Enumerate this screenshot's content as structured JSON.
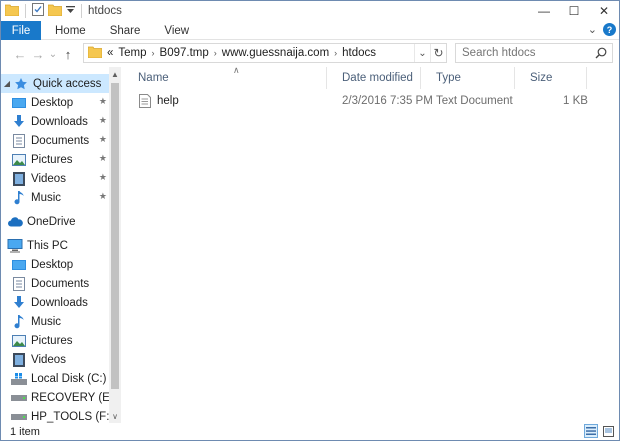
{
  "window": {
    "title": "htdocs",
    "controls": {
      "minimize": "—",
      "maximize": "☐",
      "close": "✕"
    }
  },
  "ribbon": {
    "tabs": [
      "File",
      "Home",
      "Share",
      "View"
    ],
    "expand_glyph": "⌄",
    "help_glyph": "?"
  },
  "address": {
    "back_glyph": "←",
    "forward_glyph": "→",
    "recent_glyph": "⌄",
    "up_glyph": "↑",
    "overflow": "«",
    "crumbs": [
      "Temp",
      "B097.tmp",
      "www.guessnaija.com",
      "htdocs"
    ],
    "separator": "›",
    "dropdown_glyph": "⌄",
    "refresh_glyph": "↻"
  },
  "search": {
    "placeholder": "Search htdocs"
  },
  "nav": {
    "quick_access": "Quick access",
    "quick_items": [
      "Desktop",
      "Downloads",
      "Documents",
      "Pictures",
      "Videos",
      "Music"
    ],
    "onedrive": "OneDrive",
    "this_pc": "This PC",
    "pc_items": [
      "Desktop",
      "Documents",
      "Downloads",
      "Music",
      "Pictures",
      "Videos",
      "Local Disk (C:)",
      "RECOVERY (E:)",
      "HP_TOOLS (F:)"
    ],
    "pin_glyph": "★",
    "scroll_up": "▲",
    "scroll_down": "∨"
  },
  "files": {
    "columns": {
      "name": "Name",
      "date": "Date modified",
      "type": "Type",
      "size": "Size"
    },
    "sort_glyph": "∧",
    "rows": [
      {
        "name": "help",
        "date": "2/3/2016 7:35 PM",
        "type": "Text Document",
        "size": "1 KB"
      }
    ]
  },
  "status": {
    "count": "1 item"
  },
  "colors": {
    "accent": "#1979ca",
    "selection": "#cce8ff",
    "folder": "#f5c750"
  }
}
